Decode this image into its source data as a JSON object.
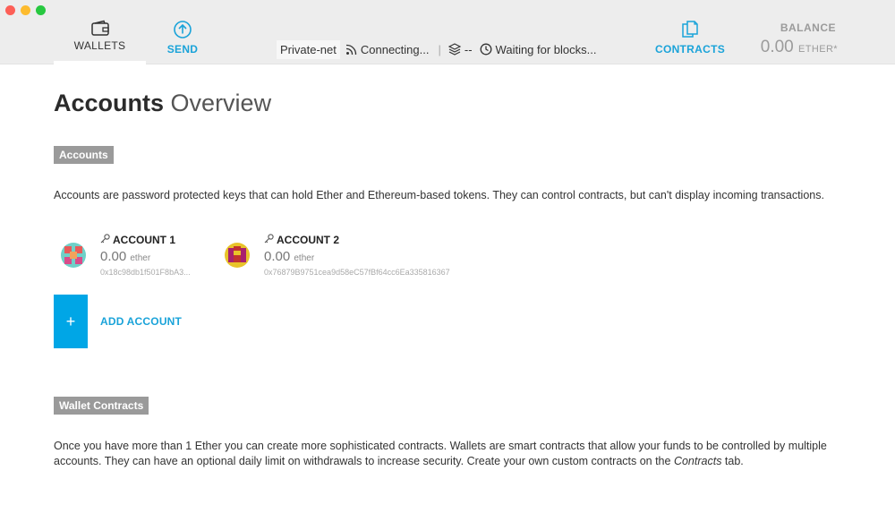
{
  "nav": {
    "wallets": "WALLETS",
    "send": "SEND",
    "contracts": "CONTRACTS"
  },
  "status": {
    "network": "Private-net",
    "connection": "Connecting...",
    "peers": "--",
    "blocks": "Waiting for blocks..."
  },
  "balance": {
    "label": "BALANCE",
    "value": "0.00",
    "unit": "ETHER*"
  },
  "page": {
    "title_strong": "Accounts",
    "title_light": "Overview"
  },
  "accounts_section": {
    "tag": "Accounts",
    "description": "Accounts are password protected keys that can hold Ether and Ethereum-based tokens. They can control contracts, but can't display incoming transactions.",
    "items": [
      {
        "name": "ACCOUNT 1",
        "balance": "0.00",
        "unit": "ether",
        "address": "0x18c98db1f501F8bA3..."
      },
      {
        "name": "ACCOUNT 2",
        "balance": "0.00",
        "unit": "ether",
        "address": "0x76879B9751cea9d58eC57fBf64cc6Ea335816367"
      }
    ],
    "add_label": "ADD ACCOUNT",
    "add_symbol": "+"
  },
  "wallet_section": {
    "tag": "Wallet Contracts",
    "text_before": "Once you have more than 1 Ether you can create more sophisticated contracts. Wallets are smart contracts that allow your funds to be controlled by multiple accounts. They can have an optional daily limit on withdrawals to increase security. Create your own custom contracts on the ",
    "text_em": "Contracts",
    "text_after": " tab."
  },
  "colors": {
    "accent": "#1aa3d9",
    "add_button": "#00a6e6",
    "tag_bg": "#9a9a9a",
    "topbar_bg": "#ededed"
  },
  "icons": {
    "wallets": "wallet-icon",
    "send": "arrow-up-circle-icon",
    "contracts": "documents-icon",
    "connection": "signal-icon",
    "peers": "layers-icon",
    "blocks": "clock-icon",
    "account": "key-icon"
  }
}
